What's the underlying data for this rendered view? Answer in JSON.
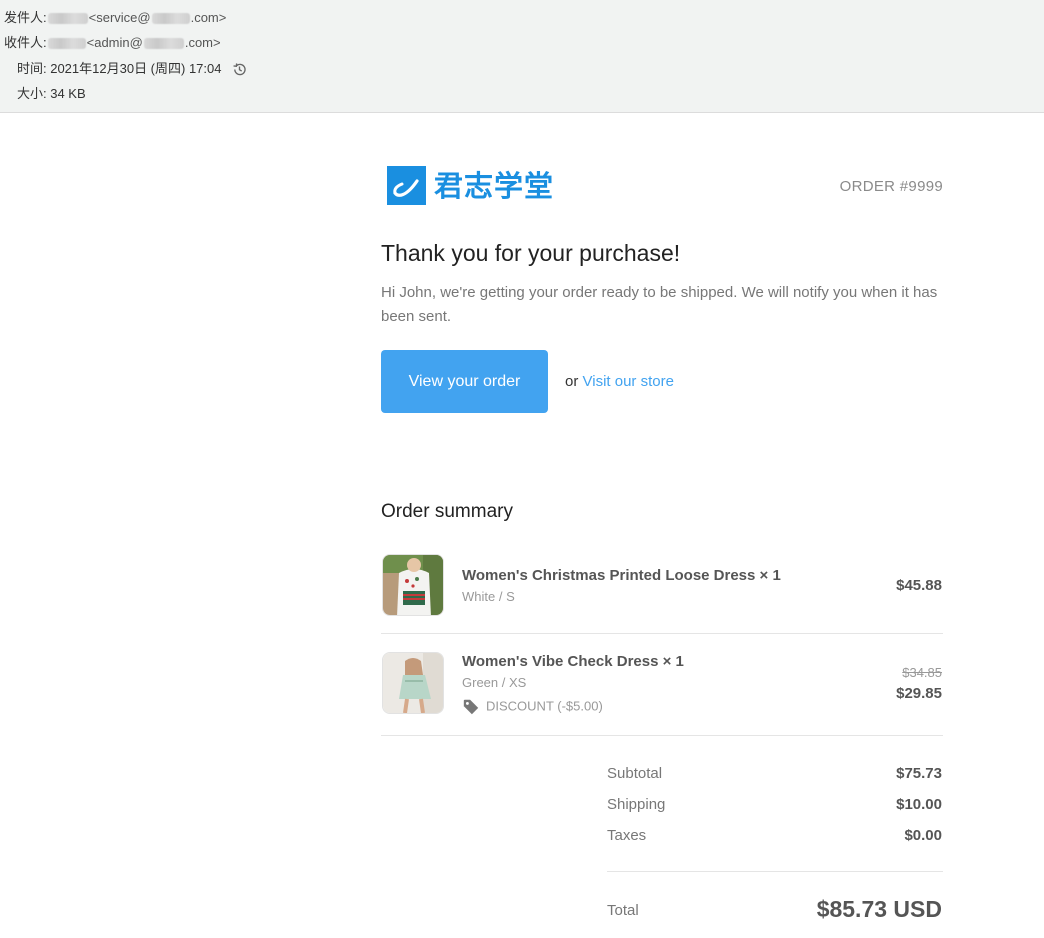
{
  "mail": {
    "from_label": "发件人:",
    "from_addr_pre": "<service@",
    "from_addr_post": ".com>",
    "to_label": "收件人:",
    "to_addr_pre": "<admin@",
    "to_addr_post": ".com>",
    "time": "时间: 2021年12月30日 (周四) 17:04",
    "size": "大小: 34 KB",
    "history_icon": "history-icon"
  },
  "brand": {
    "name": "君志学堂",
    "color": "#1a8fe0"
  },
  "order_number": "ORDER #9999",
  "heading": "Thank you for your purchase!",
  "intro": "Hi John, we're getting your order ready to be shipped. We will notify you when it has been sent.",
  "actions": {
    "view_order": "View your order",
    "or": "or",
    "visit_store": "Visit our store",
    "button_color": "#42a3f0"
  },
  "summary": {
    "title": "Order summary",
    "items": [
      {
        "name": "Women's Christmas Printed Loose Dress × 1",
        "variant": "White / S",
        "price": "$45.88"
      },
      {
        "name": "Women's Vibe Check Dress × 1",
        "variant": "Green / XS",
        "discount": "DISCOUNT (-$5.00)",
        "original_price": "$34.85",
        "price": "$29.85"
      }
    ],
    "subtotal_label": "Subtotal",
    "subtotal": "$75.73",
    "shipping_label": "Shipping",
    "shipping": "$10.00",
    "taxes_label": "Taxes",
    "taxes": "$0.00",
    "total_label": "Total",
    "total": "$85.73 USD"
  }
}
